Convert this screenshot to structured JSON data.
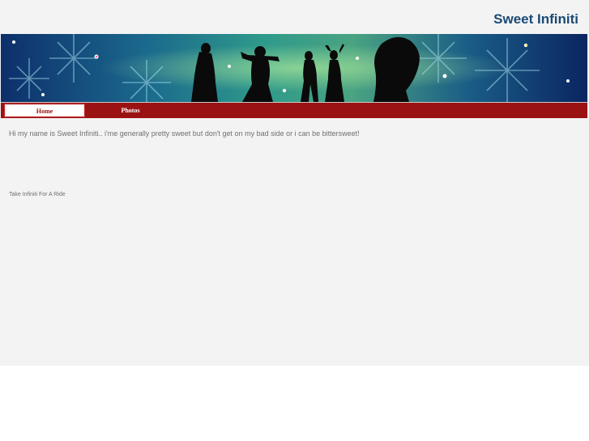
{
  "header": {
    "site_title": "Sweet Infiniti"
  },
  "nav": {
    "items": [
      {
        "label": "Home",
        "active": true
      },
      {
        "label": "Photos",
        "active": false
      }
    ]
  },
  "main": {
    "intro": "Hi my name is Sweet Infiniti..  i'me generally pretty sweet but don't get on my bad side or i can be bittersweet!",
    "link_text": "Take Infiniti For A Ride"
  },
  "colors": {
    "title": "#1a4a73",
    "nav_bar": "#9b1212",
    "nav_active_text": "#a01010",
    "page_background": "#f3f3f3"
  }
}
